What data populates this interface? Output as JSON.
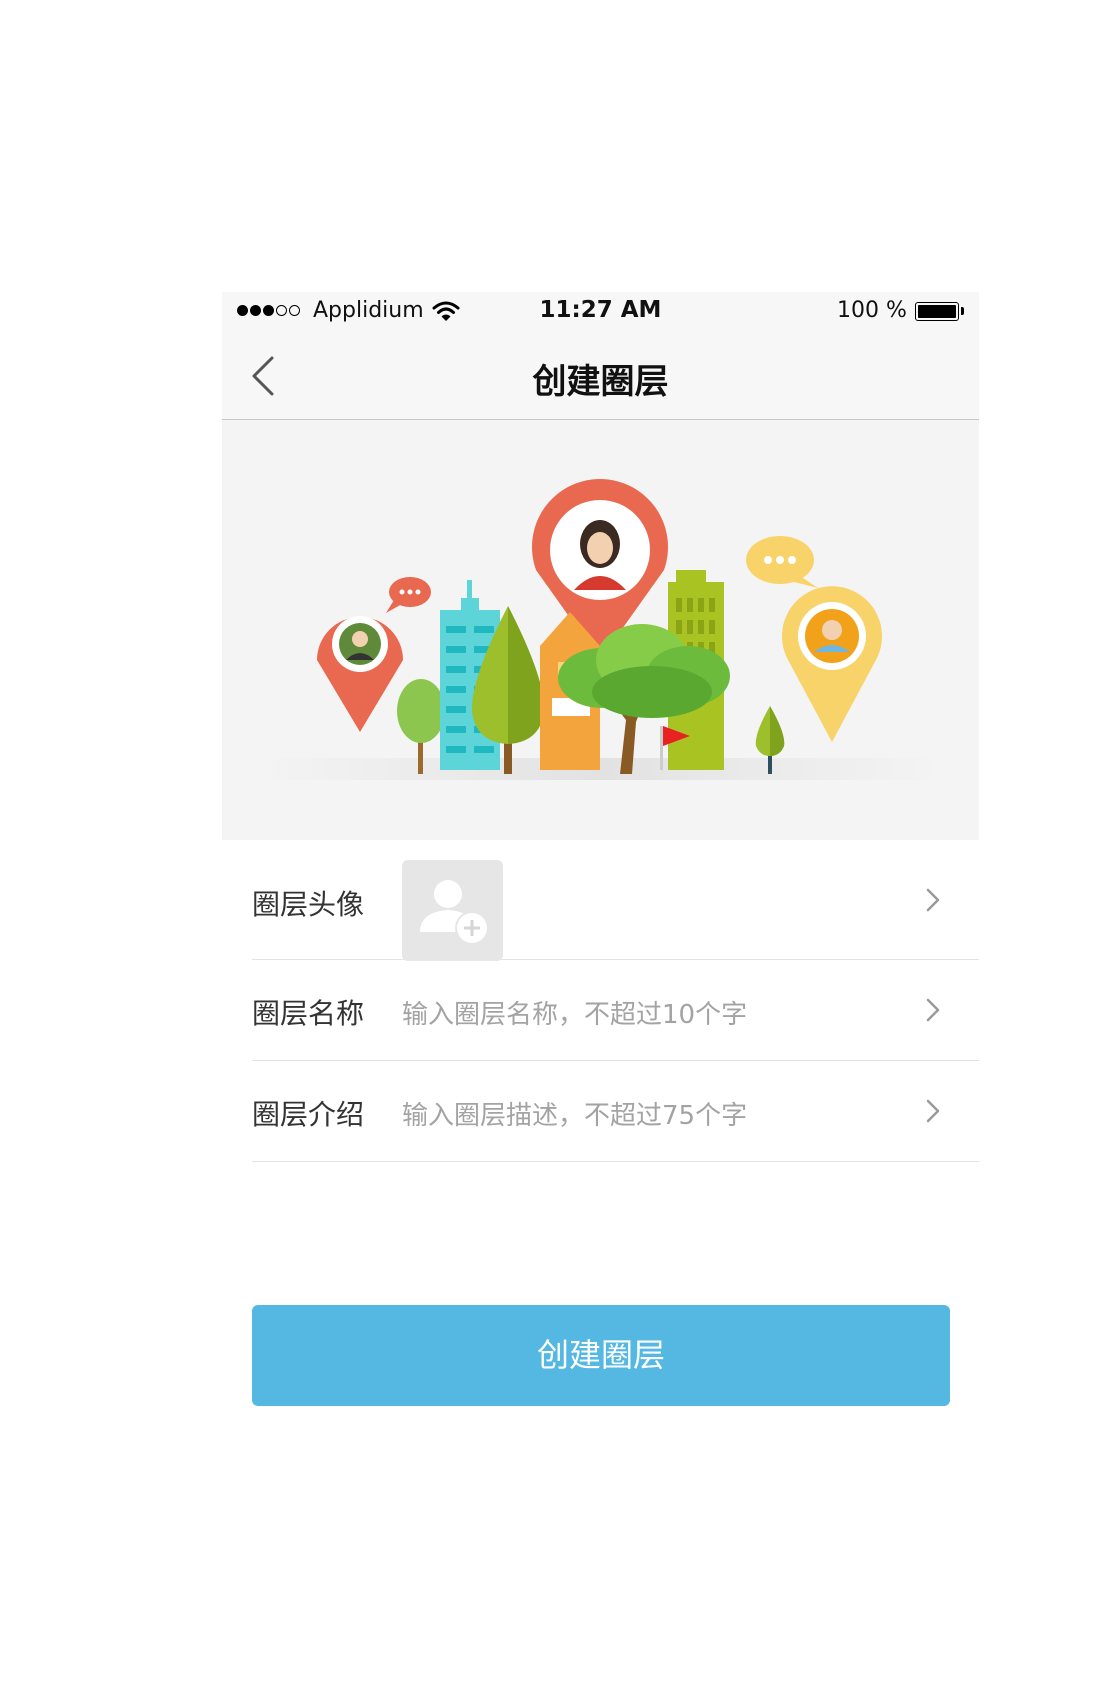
{
  "status_bar": {
    "carrier": "Applidium",
    "time": "11:27 AM",
    "battery": "100 %"
  },
  "navbar": {
    "title": "创建圈层",
    "back_icon": "chevron-left-icon"
  },
  "banner": {
    "icons": [
      "map-pin-icon",
      "avatar-icon",
      "chat-bubble-icon",
      "building-icon",
      "tree-icon",
      "flag-icon"
    ]
  },
  "form": {
    "avatar": {
      "label": "圈层头像",
      "icon": "add-user-icon"
    },
    "name": {
      "label": "圈层名称",
      "placeholder": "输入圈层名称，不超过10个字"
    },
    "intro": {
      "label": "圈层介绍",
      "placeholder": "输入圈层描述，不超过75个字"
    }
  },
  "submit_button": {
    "label": "创建圈层"
  },
  "colors": {
    "accent": "#54b8e2",
    "bar_background": "#f7f7f7",
    "banner_background": "#f4f4f4",
    "pin_red": "#e8694f",
    "pin_yellow": "#f8d36a"
  }
}
